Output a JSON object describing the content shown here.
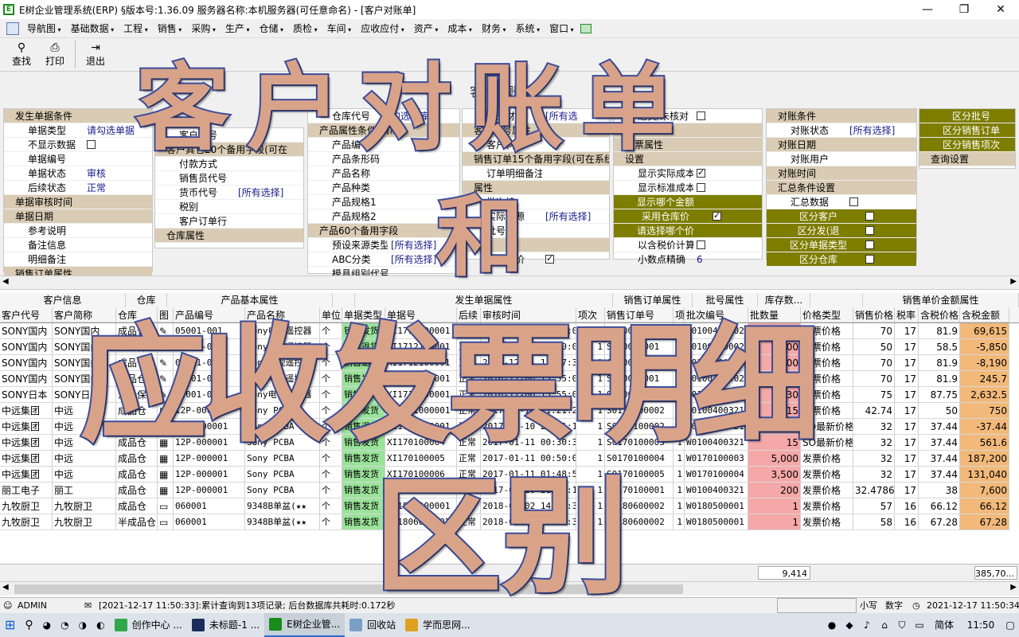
{
  "window": {
    "title": "E树企业管理系统(ERP) §版本号:1.36.09  服务器名称:本机服务器(可任意命名) - [客户对账单]",
    "minimize": "—",
    "restore": "❐",
    "close": "✕"
  },
  "menu": [
    "导航图",
    "基础数据",
    "工程",
    "销售",
    "采购",
    "生产",
    "仓储",
    "质检",
    "车间",
    "应收应付",
    "资产",
    "成本",
    "财务",
    "系统",
    "窗口"
  ],
  "toolbar": {
    "find": "查找",
    "print": "打印",
    "exit": "退出"
  },
  "form_caption": "客户对账单",
  "panel1": {
    "group1": "发生单据条件",
    "rows": [
      {
        "label": "单据类型",
        "value": "请勾选单据"
      },
      {
        "label": "不显示数据",
        "value": ""
      },
      {
        "label": "单据编号",
        "value": ""
      },
      {
        "label": "单据状态",
        "value": "审核"
      },
      {
        "label": "后续状态",
        "value": "正常"
      }
    ],
    "group2": "单据审核时间",
    "group3": "单据日期",
    "rows2": [
      {
        "label": "参考说明",
        "value": ""
      },
      {
        "label": "备注信息",
        "value": ""
      },
      {
        "label": "明细备注",
        "value": ""
      }
    ],
    "group4": "销售订单属性"
  },
  "panel2": {
    "rows": [
      {
        "label": "客户代号",
        "value": ""
      },
      {
        "label": "客户其它20个备用字段(可在",
        "value": ""
      },
      {
        "label": "付款方式",
        "value": ""
      },
      {
        "label": "销售员代号",
        "value": ""
      },
      {
        "label": "货币代号",
        "value": "[所有选择]"
      },
      {
        "label": "税别",
        "value": ""
      },
      {
        "label": "客户订单行",
        "value": ""
      }
    ],
    "group": "仓库属性"
  },
  "panel3": {
    "top": {
      "label": "仓库代号",
      "value": "勾选仓库"
    },
    "group": "产品属性条件[模糊]",
    "rows": [
      {
        "label": "产品编号",
        "value": ""
      },
      {
        "label": "产品条形码",
        "value": ""
      },
      {
        "label": "产品名称",
        "value": ""
      },
      {
        "label": "产品种类",
        "value": ""
      },
      {
        "label": "产品规格1",
        "value": ""
      },
      {
        "label": "产品规格2",
        "value": ""
      }
    ],
    "group2": "产品60个备用字段",
    "rows2": [
      {
        "label": "预设来源类型",
        "value": "[所有选择]"
      },
      {
        "label": "ABC分类",
        "value": "[所有选择]"
      },
      {
        "label": "模具组别代号",
        "value": ""
      }
    ]
  },
  "panel4": {
    "rows": [
      {
        "label": "产品财务",
        "value": "[所有选"
      },
      {
        "label": "客户料号属性",
        "value": ""
      },
      {
        "label": "客户料号",
        "value": ""
      },
      {
        "label": "销售订单15个备用字段(可在系统",
        "value": ""
      },
      {
        "label": "订单明细备注",
        "value": ""
      },
      {
        "label": "属性",
        "value": ""
      },
      {
        "label": "批次编",
        "value": ""
      },
      {
        "label": "实际来源",
        "value": "[所有选择]"
      },
      {
        "label": "批号来",
        "value": ""
      },
      {
        "label": "设置",
        "value": ""
      },
      {
        "label": "优惠单价",
        "value": ""
      }
    ]
  },
  "panel5": {
    "rows": [
      {
        "label": "退货/未核对",
        "value": ""
      },
      {
        "label": "税价",
        "value": ""
      },
      {
        "label": "发票属性",
        "value": ""
      },
      {
        "label": "设置",
        "value": ""
      },
      {
        "label": "显示实际成本",
        "value": ""
      },
      {
        "label": "显示标准成本",
        "value": ""
      },
      {
        "label": "显示哪个金额",
        "value": ""
      },
      {
        "label": "采用仓库价",
        "value": ""
      },
      {
        "label": "请选择哪个价",
        "value": ""
      },
      {
        "label": "以含税价计算",
        "value": ""
      },
      {
        "label": "小数点精确",
        "value": "6"
      }
    ]
  },
  "panel6": {
    "rows": [
      {
        "label": "对账条件",
        "value": ""
      },
      {
        "label": "对账状态",
        "value": "[所有选择]"
      },
      {
        "label": "对账日期",
        "value": ""
      },
      {
        "label": "对账用户",
        "value": ""
      },
      {
        "label": "对账时间",
        "value": ""
      }
    ],
    "group": "汇总条件设置",
    "rows2": [
      {
        "label": "汇总数据",
        "value": ""
      },
      {
        "label": "区分客户",
        "value": ""
      },
      {
        "label": "区分发(退",
        "value": ""
      },
      {
        "label": "区分单据类型",
        "value": ""
      },
      {
        "label": "区分仓库",
        "value": ""
      }
    ]
  },
  "panel7": {
    "rows": [
      {
        "label": "区分批号",
        "value": ""
      },
      {
        "label": "区分销售订单",
        "value": ""
      },
      {
        "label": "区分销售项次",
        "value": ""
      }
    ],
    "group": "查询设置"
  },
  "grid": {
    "groups": [
      {
        "label": "客户信息",
        "w": 158
      },
      {
        "label": "仓库",
        "w": 52
      },
      {
        "label": "产品基本属性",
        "w": 208
      },
      {
        "label": "",
        "w": 28
      },
      {
        "label": "发生单据属性",
        "w": 324
      },
      {
        "label": "销售订单属性",
        "w": 100
      },
      {
        "label": "批号属性",
        "w": 82
      },
      {
        "label": "库存数...",
        "w": 66
      },
      {
        "label": "",
        "w": 66
      },
      {
        "label": "销售单价金额属性",
        "w": 196
      }
    ],
    "columns": [
      "客户代号",
      "客户简称",
      "仓库",
      "图",
      "产品编号",
      "产品名称",
      "单位",
      "单据类型",
      "单据号",
      "后续",
      "审核时间",
      "项次",
      "销售订单号",
      "项",
      "批次编号",
      "批数量",
      "价格类型",
      "销售价格",
      "税率",
      "含税价格",
      "含税金额"
    ],
    "rows": [
      [
        "SONY国内",
        "SONY国内",
        "成品仓",
        "✎",
        "05001-001",
        "Sony电视遥控器",
        "个",
        "销售发货",
        "XI1712100001",
        "正常",
        "2010-12-01 12:00:00",
        "1",
        "S010040001",
        "1",
        "W0100400002",
        "850",
        "发票价格",
        "70",
        "17",
        "81.9",
        "69,615"
      ],
      [
        "SONY国内",
        "SONY国内",
        "返修待处理",
        "✎",
        "05001-001",
        "Sony电视遥控器",
        "个",
        "销售退货",
        "XI1712100001",
        "正常",
        "2010-12-01 12:00:00",
        "1",
        "S010040001",
        "1",
        "W0100400002",
        "-100",
        "发票价格",
        "50",
        "17",
        "58.5",
        "-5,850"
      ],
      [
        "SONY国内",
        "SONY国内",
        "成品仓",
        "✎",
        "05001-001",
        "Sony电视遥控器",
        "个",
        "销售退货",
        "XI1712100001",
        "正常",
        "2014-12-01 12:37:32",
        "1",
        "S010040001",
        "1",
        "W0100400002",
        "-100",
        "发票价格",
        "70",
        "17",
        "81.9",
        "-8,190"
      ],
      [
        "SONY国内",
        "SONY国内",
        "成品仓",
        "✎",
        "05001-001",
        "Sony电视遥控器",
        "个",
        "销售发货",
        "XI1712100001",
        "正常",
        "2016-12-06 15:55:07",
        "1",
        "S010040001",
        "1",
        "W0100400002",
        "3",
        "发票价格",
        "70",
        "17",
        "81.9",
        "245.7"
      ],
      [
        "SONY日本",
        "SONY日本",
        "海关保税仓",
        "✎",
        "05001-001",
        "Sony电视遥控器",
        "个",
        "销售发货",
        "XI1712100001",
        "正常",
        "2016-12-06 15:55:07",
        "1",
        "S010040001",
        "1",
        "W0100400002",
        "30",
        "发票价格",
        "75",
        "17",
        "87.75",
        "2,632.5"
      ],
      [
        "中远集团",
        "中远",
        "成品仓",
        "▦",
        "12P-000001",
        "Sony PCBA",
        "个",
        "销售发货",
        "XI1701000001",
        "正常",
        "2017-01-10 21:21:27",
        "1",
        "S0170100002",
        "1",
        "W0100400321",
        "15",
        "发票价格",
        "42.74",
        "17",
        "50",
        "750"
      ],
      [
        "中远集团",
        "中远",
        "成品仓",
        "▦",
        "12P-000001",
        "Sony PCBA",
        "个",
        "销售退货",
        "XI1701000001",
        "正常",
        "2017-01-10 23:11:14",
        "1",
        "S0170100002",
        "1",
        "W0100400321",
        "-1",
        "SO最新价格",
        "32",
        "17",
        "37.44",
        "-37.44"
      ],
      [
        "中远集团",
        "中远",
        "成品仓",
        "▦",
        "12P-000001",
        "Sony PCBA",
        "个",
        "销售发货",
        "XI170100004",
        "正常",
        "2017-01-11 00:30:33",
        "1",
        "S0170100003",
        "1",
        "W0100400321",
        "15",
        "SO最新价格",
        "32",
        "17",
        "37.44",
        "561.6"
      ],
      [
        "中远集团",
        "中远",
        "成品仓",
        "▦",
        "12P-000001",
        "Sony PCBA",
        "个",
        "销售发货",
        "XI170100005",
        "正常",
        "2017-01-11 00:50:01",
        "1",
        "S0170100004",
        "1",
        "W0170100003",
        "5,000",
        "发票价格",
        "32",
        "17",
        "37.44",
        "187,200"
      ],
      [
        "中远集团",
        "中远",
        "成品仓",
        "▦",
        "12P-000001",
        "Sony PCBA",
        "个",
        "销售发货",
        "XI170100006",
        "正常",
        "2017-01-11 01:48:51",
        "1",
        "S0170100005",
        "1",
        "W0170100004",
        "3,500",
        "发票价格",
        "32",
        "17",
        "37.44",
        "131,040"
      ],
      [
        "丽工电子",
        "丽工",
        "成品仓",
        "▦",
        "12P-000001",
        "Sony PCBA",
        "个",
        "销售发货",
        "XI1711000001",
        "正常",
        "2017-01-10 21:16:12",
        "1",
        "S0170100001",
        "1",
        "W0100400321",
        "200",
        "发票价格",
        "32.47863",
        "17",
        "38",
        "7,600"
      ],
      [
        "九牧厨卫",
        "九牧厨卫",
        "成品仓",
        "▭",
        "060001",
        "9348B单盆(★★",
        "个",
        "销售发货",
        "XI1806000001",
        "正常",
        "2018-06-02 14:46:37",
        "1",
        "S0180600002",
        "1",
        "W0180500001",
        "1",
        "发票价格",
        "57",
        "16",
        "66.12",
        "66.12"
      ],
      [
        "九牧厨卫",
        "九牧厨卫",
        "半成品仓",
        "▭",
        "060001",
        "9348B单盆(★★",
        "个",
        "销售发货",
        "XI1806000002",
        "正常",
        "2018-06-02 14:46:37",
        "1",
        "S0180600002",
        "1",
        "W0180500001",
        "1",
        "发票价格",
        "58",
        "16",
        "67.28",
        "67.28"
      ]
    ],
    "total_qty": "9,414",
    "total_amount": "385,70..."
  },
  "status": {
    "user": "ADMIN",
    "message": "[2021-12-17 11:50:33]:累计查询到13项记录; 后台数据库共耗时:0.172秒",
    "caps": "小写",
    "num": "数字",
    "clock": "2021-12-17 11:50:34"
  },
  "taskbar": {
    "apps": [
      {
        "label": "创作中心 ...",
        "color": "#2ea84a"
      },
      {
        "label": "未标题-1 ...",
        "color": "#1c2c5a"
      },
      {
        "label": "E树企业管...",
        "color": "#1a8a1a"
      },
      {
        "label": "回收站",
        "color": "#7aa0c8"
      },
      {
        "label": "学而思网...",
        "color": "#e0a020"
      }
    ],
    "ime": "简体",
    "time": "11:50"
  },
  "overlay": [
    "客户对账单",
    "和",
    "应收发票明细",
    "区别"
  ]
}
